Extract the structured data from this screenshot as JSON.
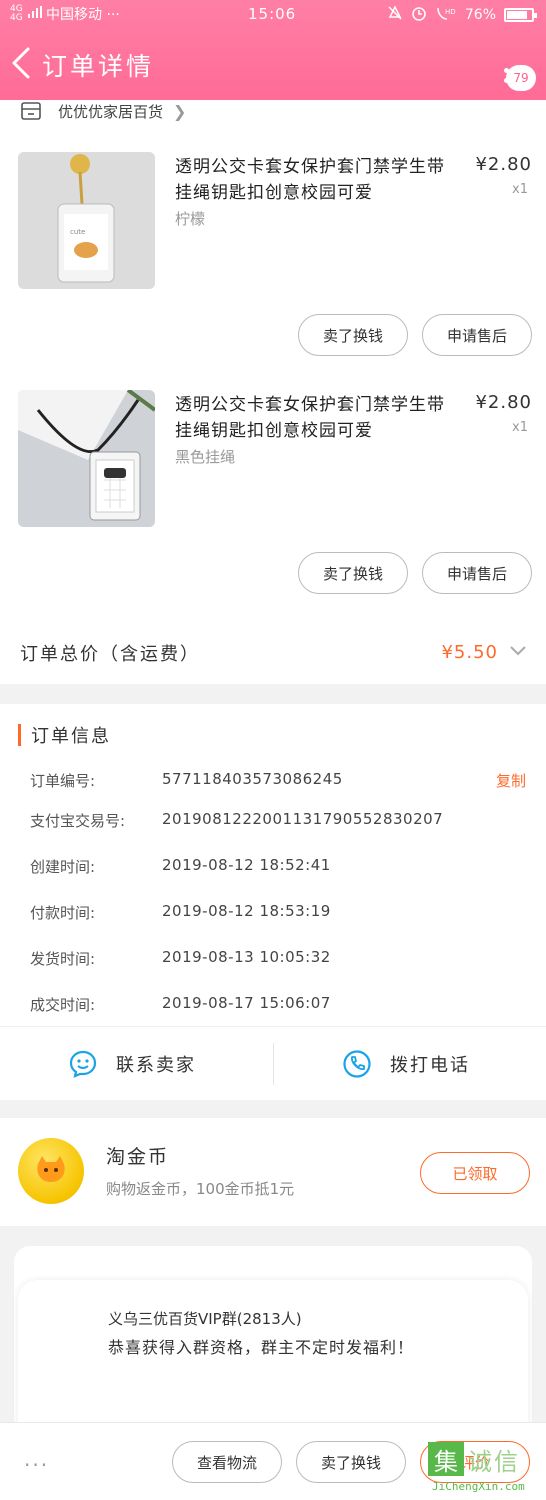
{
  "status_bar": {
    "signal_text": "4G 4G",
    "carrier": "中国移动 ···",
    "time": "15:06",
    "icons": [
      "dnd-icon",
      "alarm-icon",
      "volte-hd-icon"
    ],
    "battery": "76%",
    "battery_level": 0.76
  },
  "header": {
    "title": "订单详情",
    "badge_count": "79"
  },
  "store": {
    "name": "优优优家居百货"
  },
  "items": [
    {
      "title": "透明公交卡套女保护套门禁学生带挂绳钥匙扣创意校园可爱",
      "price": "¥2.80",
      "qty": "x1",
      "spec": "柠檬",
      "btn_return": "卖了换钱",
      "btn_service": "申请售后"
    },
    {
      "title": "透明公交卡套女保护套门禁学生带挂绳钥匙扣创意校园可爱",
      "price": "¥2.80",
      "qty": "x1",
      "spec": "黑色挂绳",
      "btn_return": "卖了换钱",
      "btn_service": "申请售后"
    }
  ],
  "total": {
    "label": "订单总价（含运费）",
    "value": "¥5.50"
  },
  "order_info": {
    "heading": "订单信息",
    "copy_label": "复制",
    "rows": [
      {
        "k": "订单编号:",
        "v": "577118403573086245"
      },
      {
        "k": "支付宝交易号:",
        "v": "2019081222001131790552830207"
      },
      {
        "k": "创建时间:",
        "v": "2019-08-12 18:52:41"
      },
      {
        "k": "付款时间:",
        "v": "2019-08-12 18:53:19"
      },
      {
        "k": "发货时间:",
        "v": "2019-08-13 10:05:32"
      },
      {
        "k": "成交时间:",
        "v": "2019-08-17 15:06:07"
      }
    ],
    "contact_seller": "联系卖家",
    "call_phone": "拨打电话"
  },
  "coin": {
    "title": "淘金币",
    "desc": "购物返金币，100金币抵1元",
    "button": "已领取"
  },
  "group": {
    "name": "义乌三优百货VIP群(2813人)",
    "message": "恭喜获得入群资格，群主不定时发福利！"
  },
  "bottom_bar": {
    "more": "···",
    "logistics": "查看物流",
    "sell": "卖了换钱",
    "review": "评价"
  },
  "watermark": {
    "char": "集",
    "text": "诚信",
    "url": "JiChengXin.com"
  },
  "colors": {
    "header_pink": "#ff6b97",
    "accent_orange": "#ff6a2a"
  }
}
